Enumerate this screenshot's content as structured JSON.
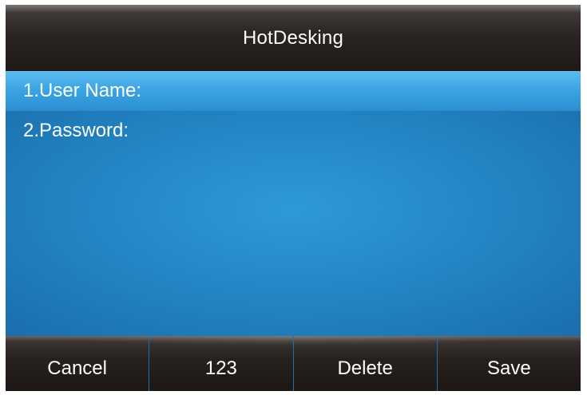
{
  "header": {
    "title": "HotDesking"
  },
  "form": {
    "items": [
      {
        "label": "1.User Name:",
        "value": ""
      },
      {
        "label": "2.Password:",
        "value": ""
      }
    ],
    "selected_index": 0
  },
  "softkeys": [
    {
      "label": "Cancel"
    },
    {
      "label": "123"
    },
    {
      "label": "Delete"
    },
    {
      "label": "Save"
    }
  ],
  "colors": {
    "background": "#1a6fb0",
    "highlight": "#3aa3e2",
    "bar": "#231d1b",
    "text": "#ffffff"
  }
}
